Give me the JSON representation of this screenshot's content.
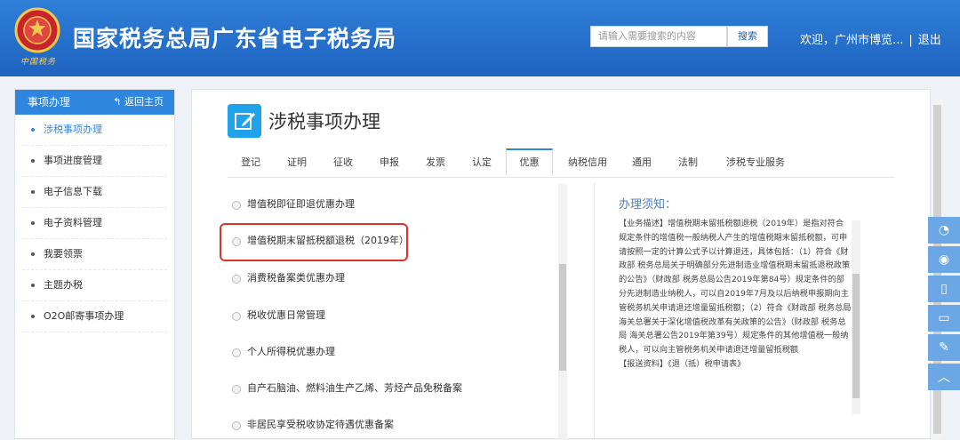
{
  "header": {
    "title": "国家税务总局广东省电子税务局",
    "emblem_text": "中国税务",
    "search_placeholder": "请输入需要搜索的内容",
    "search_button": "搜索",
    "welcome": "欢迎，广州市博览...",
    "separator": "|",
    "logout": "退出"
  },
  "sidebar": {
    "heading": "事项办理",
    "back": "返回主页",
    "items": [
      {
        "label": "涉税事项办理"
      },
      {
        "label": "事项进度管理"
      },
      {
        "label": "电子信息下载"
      },
      {
        "label": "电子资料管理"
      },
      {
        "label": "我要领票"
      },
      {
        "label": "主题办税"
      },
      {
        "label": "O2O邮寄事项办理"
      }
    ]
  },
  "main": {
    "title": "涉税事项办理",
    "tabs": [
      {
        "label": "登记"
      },
      {
        "label": "证明"
      },
      {
        "label": "征收"
      },
      {
        "label": "申报"
      },
      {
        "label": "发票"
      },
      {
        "label": "认定"
      },
      {
        "label": "优惠"
      },
      {
        "label": "纳税信用"
      },
      {
        "label": "通用"
      },
      {
        "label": "法制"
      },
      {
        "label": "涉税专业服务"
      }
    ],
    "active_tab": "优惠",
    "items": [
      {
        "label": "增值税即征即退优惠办理"
      },
      {
        "label": "增值税期末留抵税额退税（2019年）"
      },
      {
        "label": "消费税备案类优惠办理"
      },
      {
        "label": "税收优惠日常管理"
      },
      {
        "label": "个人所得税优惠办理"
      },
      {
        "label": "自产石脑油、燃料油生产乙烯、芳烃产品免税备案"
      },
      {
        "label": "非居民享受税收协定待遇优惠备案"
      }
    ],
    "notice": {
      "title": "办理须知：",
      "paragraphs": [
        "【业务描述】增值税期末留抵税额退税（2019年）是指对符合规定条件的增值税一般纳税人产生的增值税期末留抵税额，可申请按照一定的计算公式予以计算退还，具体包括：（1）符合《财政部 税务总局关于明确部分先进制造业增值税期末留抵退税政策的公告》（财政部 税务总局公告2019年第84号）规定条件的部分先进制造业纳税人，可以自2019年7月及以后纳税申报期向主管税务机关申请退还增量留抵税额；（2）符合《财政部 税务总局 海关总署关于深化增值税改革有关政策的公告》（财政部 税务总局 海关总署公告2019年第39号）规定条件的其他增值税一般纳税人，可以向主管税务机关申请退还增量留抵税额",
        "【报送资料】《退（抵）税申请表》"
      ]
    }
  },
  "colors": {
    "header": "#2f7fd8",
    "accent": "#2f86df",
    "highlight": "#d9342b"
  }
}
